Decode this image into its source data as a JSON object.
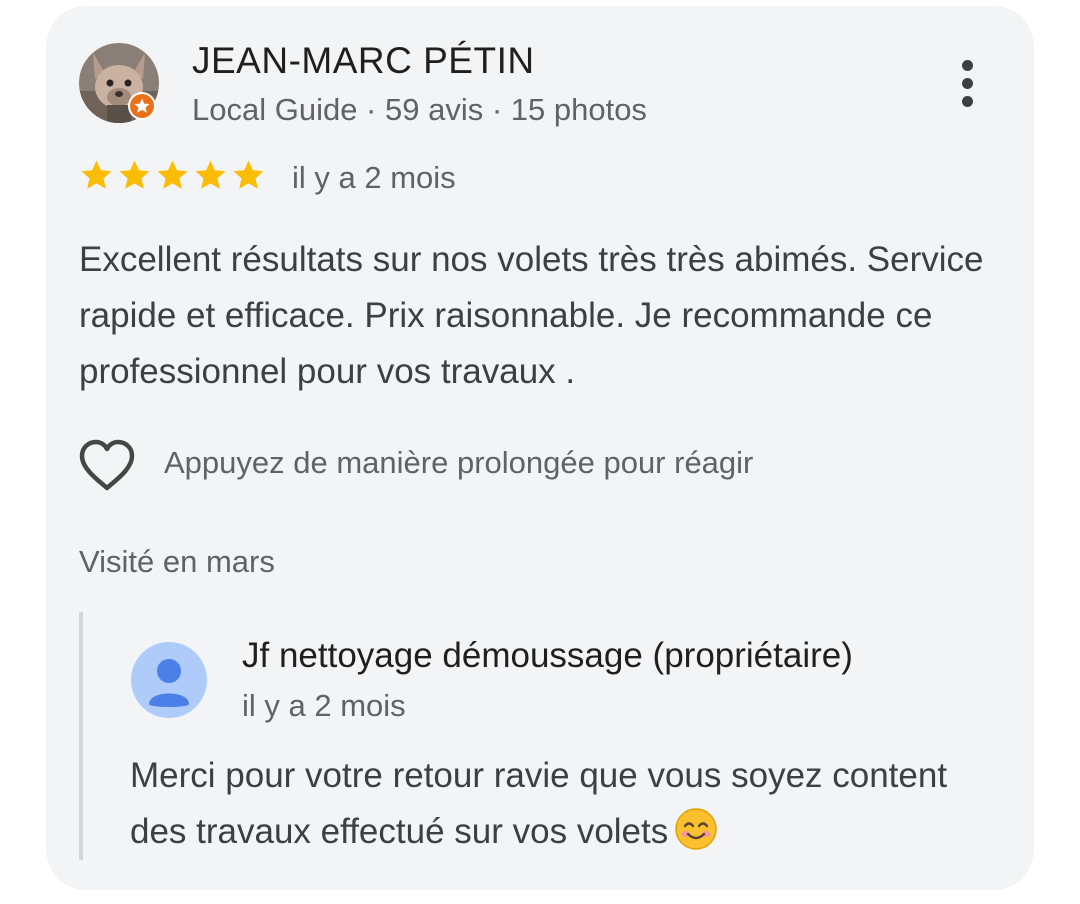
{
  "reviewer": {
    "name": "JEAN-MARC PÉTIN",
    "meta": "Local Guide · 59 avis · 15 photos",
    "avatar_icon": "dog-photo-avatar",
    "badge_icon": "local-guide-star-badge",
    "badge_color": "#e8711a"
  },
  "menu": {
    "icon": "more-vert-icon"
  },
  "rating": {
    "stars": 5,
    "max": 5,
    "color": "#fbbc04",
    "time": "il y a 2 mois"
  },
  "review": {
    "text": "Excellent résultats sur nos volets très très abimés. Service rapide et efficace. Prix raisonnable. Je recommande ce professionnel pour vos travaux ."
  },
  "reaction": {
    "icon": "heart-outline-icon",
    "label": "Appuyez de manière prolongée pour réagir"
  },
  "visit": {
    "text": "Visité en mars"
  },
  "owner_reply": {
    "name": "Jf nettoyage démoussage (propriétaire)",
    "time": "il y a 2 mois",
    "avatar_icon": "default-person-avatar",
    "avatar_color": "#aecbfa",
    "text": "Merci pour votre retour ravie que vous soyez content des travaux effectué sur vos volets",
    "emoji_icon": "smiling-face-icon"
  }
}
